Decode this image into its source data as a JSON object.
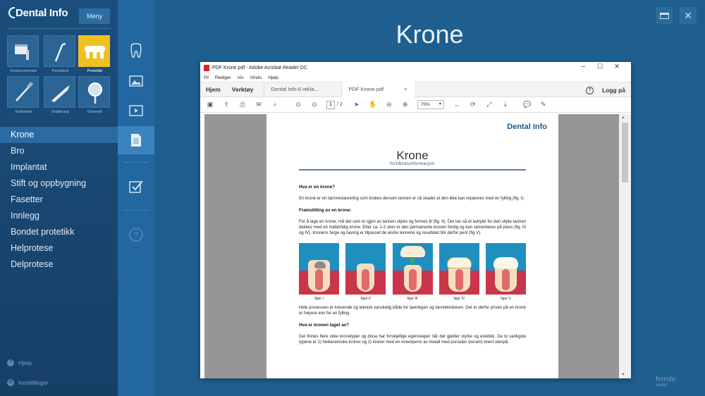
{
  "app": {
    "logo": "Dental Info",
    "menu_button": "Meny"
  },
  "categories": [
    {
      "label": "Konserverende",
      "active": false
    },
    {
      "label": "Periodont",
      "active": false
    },
    {
      "label": "Protetikk",
      "active": true
    },
    {
      "label": "Endodont",
      "active": false
    },
    {
      "label": "Oralkirurgi",
      "active": false
    },
    {
      "label": "Generelt",
      "active": false
    }
  ],
  "nav": [
    "Krone",
    "Bro",
    "Implantat",
    "Stift og oppbygning",
    "Fasetter",
    "Innlegg",
    "Bondet protetikk",
    "Helprotese",
    "Delprotese"
  ],
  "footer": {
    "help": "Hjelp",
    "settings": "Innstillinger"
  },
  "page_title": "Krone",
  "branding": {
    "name": "ferrule",
    "sub": "media"
  },
  "acrobat": {
    "window_title": "PDF Krone.pdf - Adobe Acrobat Reader DC",
    "menu": [
      "Fil",
      "Rediger",
      "Vis",
      "Vindu",
      "Hjelp"
    ],
    "nav_tabs": [
      "Hjem",
      "Verktøy"
    ],
    "doc_tabs": [
      "Dental Info 6 rekla...",
      "PDF Krone.pdf"
    ],
    "login": "Logg på",
    "help_glyph": "?",
    "page_current": "1",
    "page_total": "/ 2",
    "zoom": "75%",
    "close_glyph": "×"
  },
  "document": {
    "logo": "Dental Info",
    "title": "Krone",
    "subtitle": "forhåndsinformasjon",
    "h1": "Hva er en krone?",
    "p1": "En krone er en tannrestaurering som brukes dersom tannen er så skadet at den ikke kan repareres med en fylling (fig. I).",
    "h2": "Framstilling av en krone:",
    "p2": "For å lage en krone, må det som er igjen av tannen slipes og formes til (fig. II). Det tas så et avtrykk for den slipte tannen dekkes med en midlertidig krone.  Etter ca. 1-2 uker er den permanente kronen ferdig og kan sementeres på plass (fig. III og IV). Kronens farge og fasong er tilpasset de andre tennene og resultatet blir derfor pent (fig V).",
    "figures": [
      "figur I",
      "figur II",
      "figur III",
      "figur IV",
      "figur V"
    ],
    "p3": "Hele prosessen er krevende og teknisk vanskelig både for tannlegen og tannteknikeren. Det er derfor prisen på en krone er høyere enn for en fylling.",
    "h3": "Hva er kronen laget av?",
    "p4": "Det finnes flere ulike kronetyper og disse har forskjellige egenskaper  når det gjelder styrke og estetikk. De to vanligste typene er 1) helkeramiske kroner og 2) kroner med en innerkjerne av metall med porselen (keram) brent utenpå."
  },
  "colors": {
    "background": "#1f5f8f",
    "sidebar": "#1b4e7c",
    "accent": "#f0c020",
    "nav_active": "#2c6aa2"
  }
}
